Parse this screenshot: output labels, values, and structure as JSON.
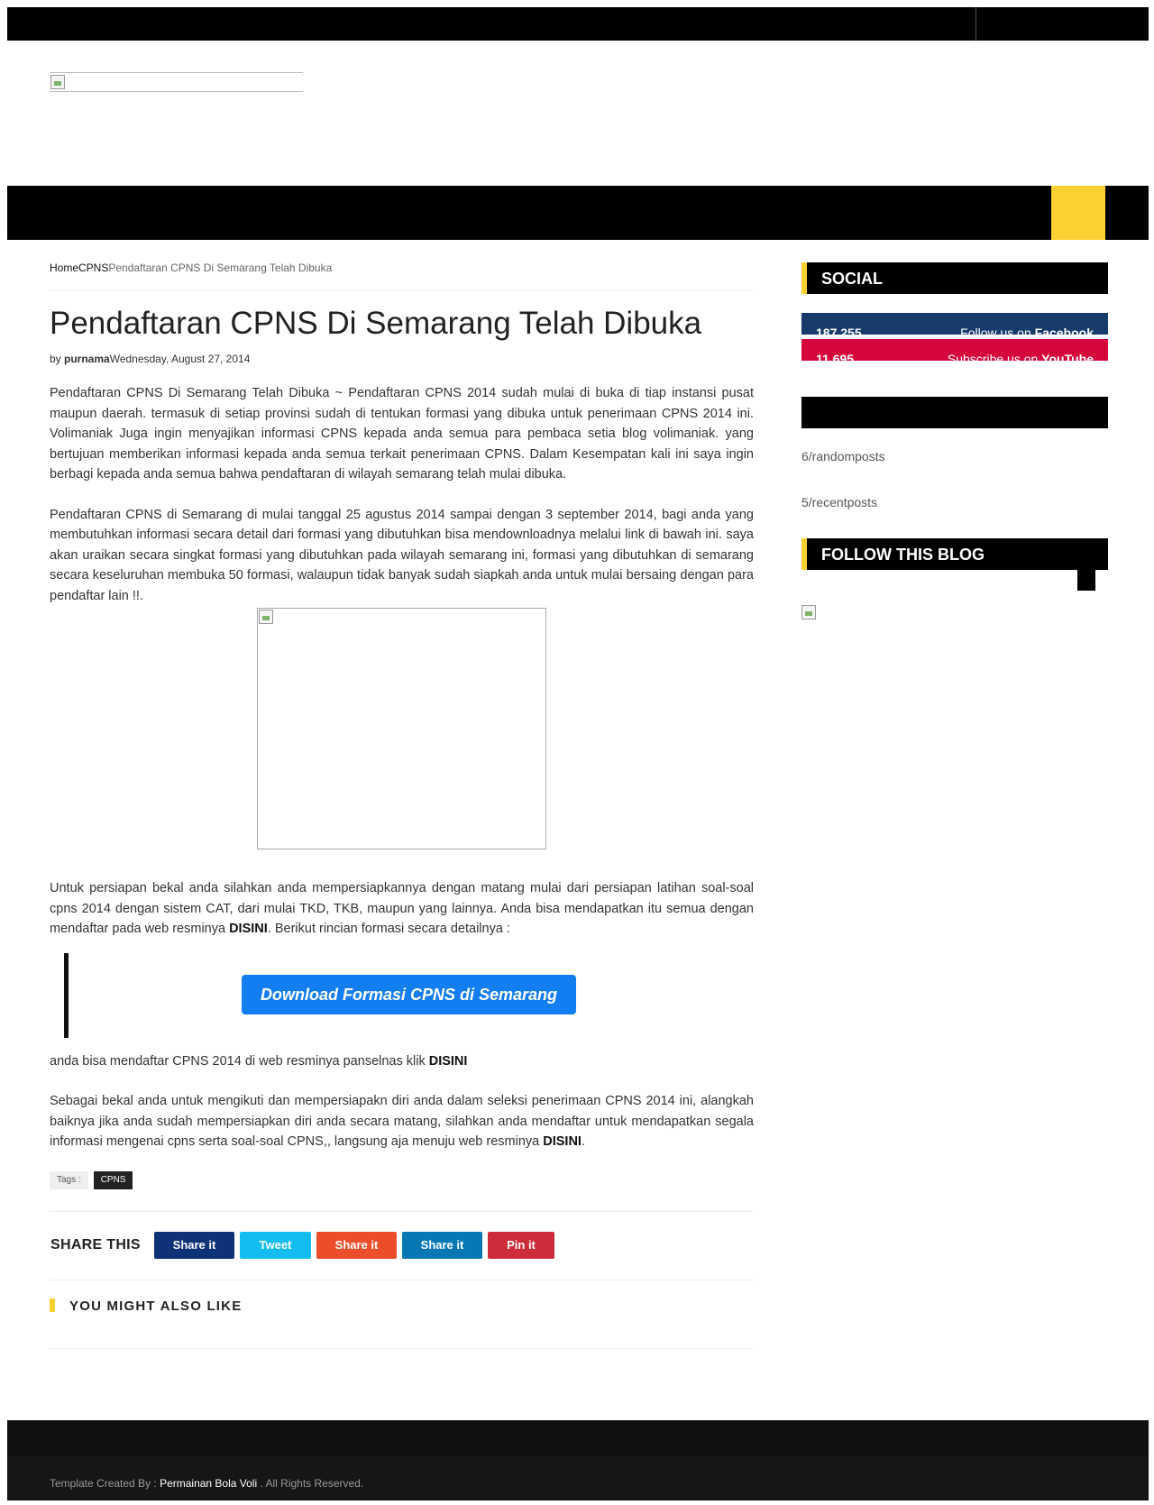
{
  "breadcrumb": {
    "home": "Home",
    "category": "CPNS",
    "current": "Pendaftaran CPNS Di Semarang Telah Dibuka"
  },
  "post": {
    "title": "Pendaftaran CPNS Di Semarang Telah Dibuka",
    "by": "by ",
    "author": "purnama",
    "date": "Wednesday, August 27, 2014",
    "p1": "Pendaftaran CPNS Di Semarang Telah Dibuka ~ Pendaftaran CPNS 2014 sudah mulai di buka di tiap instansi pusat maupun daerah. termasuk di setiap provinsi sudah di tentukan formasi yang dibuka untuk penerimaan CPNS 2014 ini. Volimaniak Juga ingin menyajikan informasi CPNS kepada anda semua para pembaca setia blog volimaniak. yang bertujuan memberikan informasi kepada anda semua terkait penerimaan CPNS. Dalam Kesempatan kali ini saya ingin berbagi kepada anda semua bahwa pendaftaran di wilayah semarang telah mulai dibuka.",
    "p2": "Pendaftaran CPNS di Semarang di mulai tanggal 25 agustus 2014 sampai dengan 3 september 2014, bagi anda yang membutuhkan informasi secara detail dari formasi yang dibutuhkan bisa mendownloadnya melalui link di bawah ini. saya akan uraikan secara singkat formasi yang dibutuhkan pada wilayah semarang ini, formasi yang dibutuhkan di semarang secara keseluruhan membuka 50 formasi, walaupun tidak banyak sudah siapkah anda untuk mulai bersaing dengan para pendaftar lain !!.",
    "p3_before": "Untuk persiapan bekal anda silahkan anda mempersiapkannya dengan matang mulai dari persiapan latihan soal-soal cpns 2014 dengan sistem CAT, dari mulai TKD, TKB, maupun yang lainnya. Anda bisa mendapatkan itu semua dengan mendaftar pada web resminya ",
    "p3_link": "DISINI",
    "p3_after": ".  Berikut rincian formasi secara detailnya :",
    "download_label": "Download Formasi CPNS di Semarang",
    "p4_before": " anda bisa mendaftar CPNS 2014 di web resminya panselnas klik ",
    "p4_link": "DISINI",
    "p5_before": "Sebagai bekal anda untuk mengikuti dan mempersiapakn diri anda dalam seleksi penerimaan CPNS 2014 ini, alangkah baiknya jika anda sudah mempersiapkan diri anda secara matang, silahkan anda mendaftar untuk mendapatkan segala informasi mengenai cpns serta soal-soal CPNS,, langsung aja menuju web resminya ",
    "p5_link": "DISINI",
    "p5_after": "."
  },
  "tags": {
    "label": "Tags :",
    "items": [
      "CPNS"
    ]
  },
  "share": {
    "title": "SHARE THIS",
    "buttons": [
      {
        "label": "Share it",
        "color": "#0d3275"
      },
      {
        "label": "Tweet",
        "color": "#14bdf1"
      },
      {
        "label": "Share it",
        "color": "#ec4d2a"
      },
      {
        "label": "Share it",
        "color": "#0878b5"
      },
      {
        "label": "Pin it",
        "color": "#cd2d3a"
      }
    ]
  },
  "related": {
    "title": "YOU MIGHT ALSO LIKE"
  },
  "sidebar": {
    "social_title": "SOCIAL",
    "facebook": {
      "count": "187,255",
      "text": "Follow us on ",
      "brand": "Facebook",
      "color": "#173b6b"
    },
    "youtube": {
      "count": "11,695",
      "text": "Subscribe us on ",
      "brand": "YouTube",
      "color": "#d4063b"
    },
    "random_posts": "6/randomposts",
    "recent_posts": "5/recentposts",
    "follow_title": "FOLLOW THIS BLOG"
  },
  "footer": {
    "prefix": "Template Created By : ",
    "author": "Permainan Bola Voli",
    "suffix": " . All Rights Reserved."
  },
  "colors": {
    "accent": "#fdd032",
    "button_blue": "#137df2"
  }
}
